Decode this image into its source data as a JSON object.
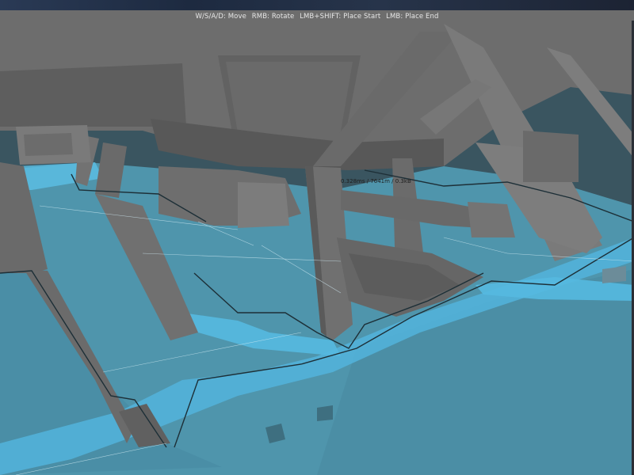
{
  "window": {
    "controls_hint": {
      "move": "W/S/A/D: Move",
      "rotate": "RMB: Rotate",
      "place_start": "LMB+SHIFT: Place Start",
      "place_end": "LMB: Place End"
    },
    "perf_readout": "0.328ms / 7641m / 0.3kB"
  },
  "colors": {
    "navmesh": "#4fa7c7",
    "geometry": "#6f6f6f",
    "edge": "#1b2b33",
    "polygon_lines": "#d8eef5"
  }
}
